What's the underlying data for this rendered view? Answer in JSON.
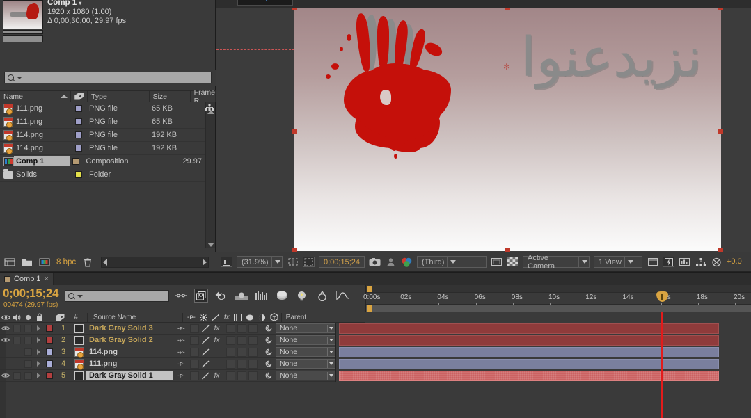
{
  "project": {
    "title": "Comp 1",
    "caret": "▾",
    "dimensions": "1920 x 1080 (1.00)",
    "duration_fps": "Δ 0;00;30;00, 29.97 fps",
    "search_placeholder": "",
    "columns": [
      "Name",
      "Type",
      "Size",
      "Frame R..."
    ],
    "bit_depth": "8 bpc",
    "items": [
      {
        "name": "111.png",
        "icon": "png-file-icon",
        "type": "PNG file",
        "size": "65 KB",
        "frame_rate": "",
        "label_color": "#9f9fc8",
        "selected": false
      },
      {
        "name": "111.png",
        "icon": "png-file-icon",
        "type": "PNG file",
        "size": "65 KB",
        "frame_rate": "",
        "label_color": "#9f9fc8",
        "selected": false
      },
      {
        "name": "114.png",
        "icon": "png-file-icon",
        "type": "PNG file",
        "size": "192 KB",
        "frame_rate": "",
        "label_color": "#9f9fc8",
        "selected": false
      },
      {
        "name": "114.png",
        "icon": "png-file-icon",
        "type": "PNG file",
        "size": "192 KB",
        "frame_rate": "",
        "label_color": "#9f9fc8",
        "selected": false
      },
      {
        "name": "Comp 1",
        "icon": "composition-icon",
        "type": "Composition",
        "size": "",
        "frame_rate": "29.97",
        "label_color": "#b59a72",
        "selected": true
      },
      {
        "name": "Solids",
        "icon": "folder-icon",
        "type": "Folder",
        "size": "",
        "frame_rate": "",
        "label_color": "#e3e04a",
        "selected": false
      }
    ]
  },
  "viewer": {
    "zoom": "(31.9%)",
    "timecode": "0;00;15;24",
    "resolution": "(Third)",
    "camera": "Active Camera",
    "views": "1 View",
    "exposure": "+0.0",
    "artwork_text": "نزيدعنوا"
  },
  "timeline": {
    "tab_label": "Comp 1",
    "tab_close": "×",
    "timecode": "0;00;15;24",
    "frame_info": "00474 (29.97 fps)",
    "search_placeholder": "",
    "columns": {
      "number": "#",
      "source_name": "Source Name",
      "parent": "Parent"
    },
    "ruler_ticks": [
      "0:00s",
      "02s",
      "04s",
      "06s",
      "08s",
      "10s",
      "12s",
      "14s",
      "16s",
      "18s",
      "20s"
    ],
    "playhead_time": "16s",
    "layers": [
      {
        "num": "1",
        "name": "Dark Gray Solid 3",
        "kind": "solid",
        "visible": true,
        "selected": false,
        "has_fx": true,
        "label_color": "#b33f3f",
        "bar_color": "red",
        "parent": "None"
      },
      {
        "num": "2",
        "name": "Dark Gray Solid 2",
        "kind": "solid",
        "visible": true,
        "selected": false,
        "has_fx": true,
        "label_color": "#b33f3f",
        "bar_color": "red",
        "parent": "None"
      },
      {
        "num": "3",
        "name": "114.png",
        "kind": "png",
        "visible": false,
        "selected": false,
        "has_fx": false,
        "label_color": "#aaaed8",
        "bar_color": "blue",
        "parent": "None"
      },
      {
        "num": "4",
        "name": "111.png",
        "kind": "png",
        "visible": false,
        "selected": false,
        "has_fx": false,
        "label_color": "#aaaed8",
        "bar_color": "blue",
        "parent": "None"
      },
      {
        "num": "5",
        "name": "Dark Gray Solid 1",
        "kind": "solid",
        "visible": true,
        "selected": true,
        "has_fx": true,
        "label_color": "#b33f3f",
        "bar_color": "brightred",
        "parent": "None"
      }
    ]
  },
  "colors": {
    "accent_orange": "#d9a441",
    "playhead_red": "#e31b1b",
    "blood_red": "#c5100a",
    "panel_bg": "#3a3a3a"
  }
}
